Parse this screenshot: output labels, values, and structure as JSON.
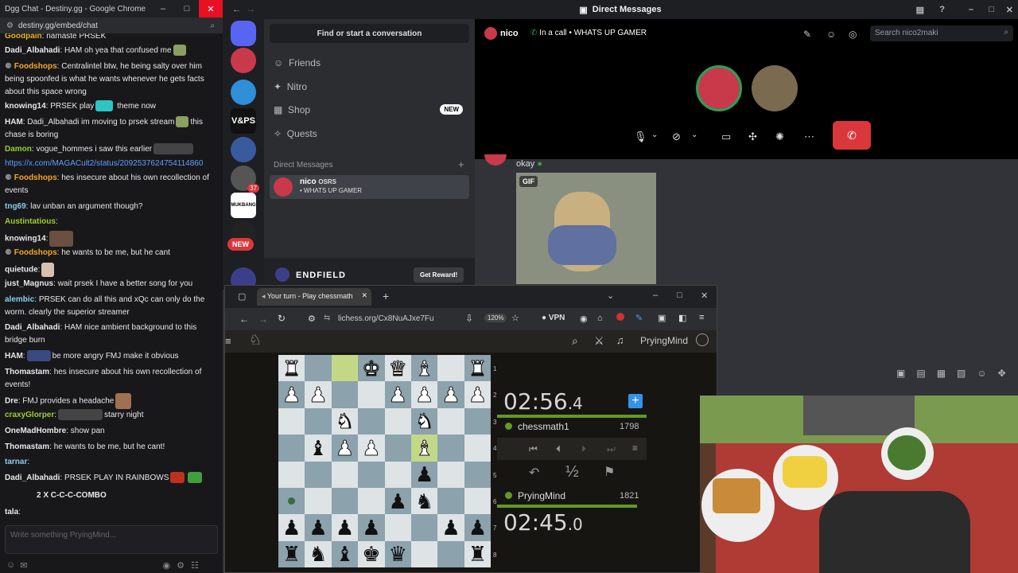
{
  "chat_window": {
    "title": "Dgg Chat - Destiny.gg - Google Chrome",
    "url": "destiny.gg/embed/chat",
    "messages": [
      {
        "user": "Goodpain",
        "text": "namaste PRSEK",
        "color": "#e6b422"
      },
      {
        "user": "Dadi_Albahadi",
        "text": "HAM oh yea that confused me",
        "color": "#ffffff"
      },
      {
        "user": "Foodshops",
        "text": "Centralintel btw, he being salty over him being spoonfed is what he wants whenever he gets facts about this space wrong",
        "color": "#f5a623"
      },
      {
        "user": "knowing14",
        "text": "PRSEK play",
        "text2": "theme now",
        "color": "#ffffff"
      },
      {
        "user": "HAM",
        "text": "Dadi_Albahadi im moving to prsek stream",
        "text2": "this chase is boring",
        "color": "#ffffff"
      },
      {
        "user": "Damon",
        "text": "vogue_hommes i saw this earlier",
        "color": "#9acd32"
      },
      {
        "user": "",
        "text": "https://x.com/MAGACult2/status/2092537624754114860",
        "color": "#5aa0ff"
      },
      {
        "user": "Foodshops",
        "text": "hes insecure about his own recollection of events",
        "color": "#f5a623"
      },
      {
        "user": "tng69",
        "text": "lav unban an argument though?",
        "color": "#87ceeb"
      },
      {
        "user": "Austintatious",
        "text": "",
        "color": "#9acd32"
      },
      {
        "user": "knowing14",
        "text": "",
        "color": "#ffffff"
      },
      {
        "user": "Foodshops",
        "text": "he wants to be me, but he cant",
        "color": "#f5a623"
      },
      {
        "user": "quietude",
        "text": "",
        "color": "#ffffff"
      },
      {
        "user": "just_Magnus",
        "text": "wait prsek I have a better song for you",
        "color": "#ffffff"
      },
      {
        "user": "alembic",
        "text": "PRSEK can do all this and xQc can only do the worm. clearly the superior streamer",
        "color": "#87ceeb"
      },
      {
        "user": "Dadi_Albahadi",
        "text": "HAM nice ambient background to this bridge burn",
        "color": "#ffffff"
      },
      {
        "user": "HAM",
        "text": "be more angry FMJ make it obvious",
        "color": "#ffffff"
      },
      {
        "user": "Thomastam",
        "text": "hes insecure about his own recollection of events!",
        "color": "#ffffff"
      },
      {
        "user": "Dre",
        "text": "FMJ provides a headache",
        "color": "#ffffff"
      },
      {
        "user": "craxyGlorper",
        "text": "starry night",
        "color": "#9acd32"
      },
      {
        "user": "OneMadHombre",
        "text": "show pan",
        "color": "#ffffff"
      },
      {
        "user": "Thomastam",
        "text": "he wants to be me, but he cant!",
        "color": "#ffffff"
      },
      {
        "user": "tarnar",
        "text": "",
        "color": "#87ceeb"
      },
      {
        "user": "Dadi_Albahadi",
        "text": "PRSEK PLAY IN RAINBOWS",
        "color": "#ffffff"
      },
      {
        "user": "",
        "text": "2 X C-C-C-COMBO",
        "color": "#ffffff"
      },
      {
        "user": "tala",
        "text": "",
        "color": "#ffffff"
      }
    ],
    "input_placeholder": "Write something PryingMind..."
  },
  "discord": {
    "title": "Direct Messages",
    "find_label": "Find or start a conversation",
    "nav": [
      {
        "label": "Friends",
        "icon": "friends-icon"
      },
      {
        "label": "Nitro",
        "icon": "nitro-icon"
      },
      {
        "label": "Shop",
        "icon": "shop-icon",
        "badge": "NEW"
      },
      {
        "label": "Quests",
        "icon": "quests-icon"
      }
    ],
    "dm_header": "Direct Messages",
    "dm": {
      "name": "nico",
      "game": "OSRS",
      "status": "• WHATS UP GAMER"
    },
    "server_labels": {
      "vps": "V&PS",
      "badge37": "37",
      "mukbang": "MUKBANG",
      "newbadge": "NEW"
    },
    "banner": {
      "title": "ENDFIELD",
      "button": "Get Reward!"
    },
    "call": {
      "name": "nico",
      "in_call": "In a call",
      "status": "WHATS UP GAMER",
      "search": "Search nico2maki"
    },
    "message": {
      "text": "okay",
      "gif_label": "GIF"
    }
  },
  "lichess": {
    "tab_title": "Your turn - Play chessmath",
    "url": "lichess.org/Cx8NuAJxe7Fu",
    "zoom": "120%",
    "vpn": "VPN",
    "username": "PryingMind",
    "opponent": {
      "name": "chessmath1",
      "rating": "1798",
      "time": "02:56",
      "tenths": ".4"
    },
    "player": {
      "name": "PryingMind",
      "rating": "1821",
      "time": "02:45",
      "tenths": ".0"
    },
    "draw": "½",
    "ranks": [
      "1",
      "2",
      "3",
      "4",
      "5",
      "6",
      "7",
      "8"
    ]
  },
  "colors": {
    "discord_blurple": "#5865f2",
    "hangup": "#da373c",
    "lichess_green": "#629924"
  }
}
